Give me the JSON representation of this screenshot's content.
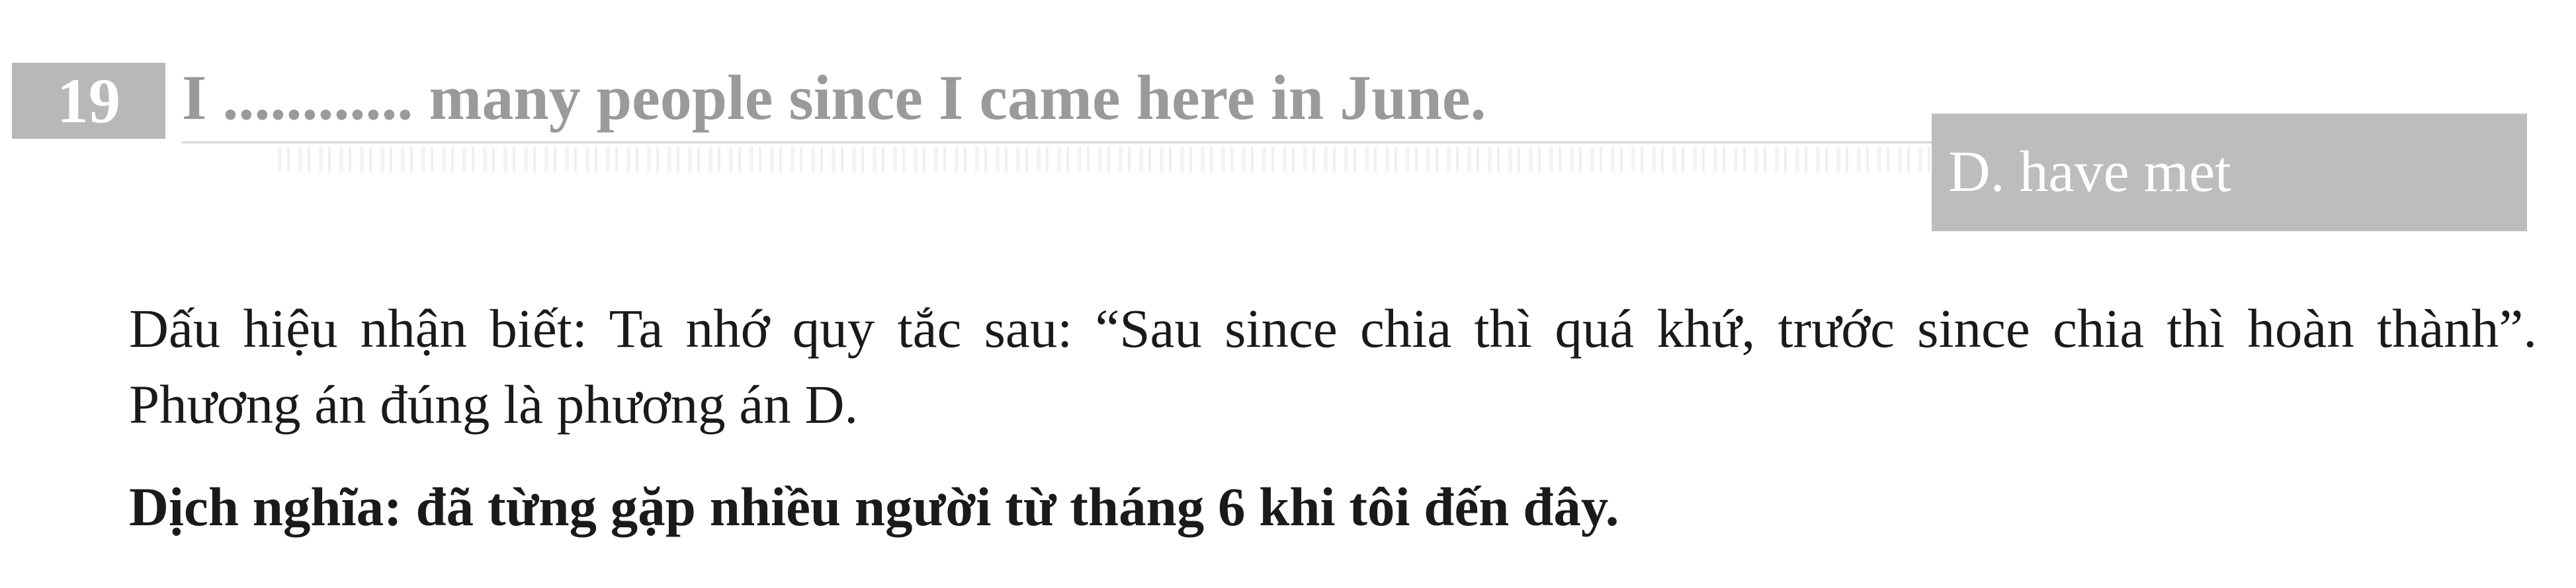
{
  "question": {
    "number": "19",
    "text": "I ............ many people since I came here in June."
  },
  "answer": {
    "label": "D. have met"
  },
  "explanation": {
    "text": "Dấu hiệu nhận biết: Ta nhớ quy tắc sau: “Sau since chia thì quá khứ, trước since chia thì hoàn thành”. Phương án đúng là phương án D."
  },
  "translation": {
    "text": "Dịch nghĩa: đã từng gặp nhiều người từ tháng 6 khi tôi đến đây."
  },
  "colors": {
    "badge_bg": "#b8b8b8",
    "question_text": "#9a9a9a",
    "answer_bg": "#bdbdbd",
    "body_text": "#1a1a1a"
  }
}
